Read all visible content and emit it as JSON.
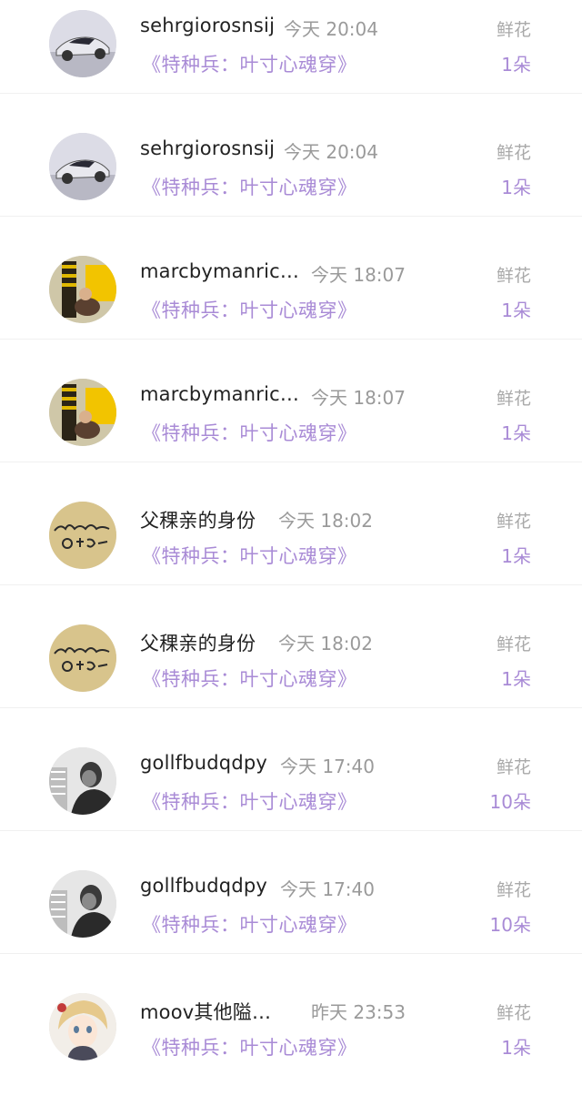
{
  "rows": [
    {
      "name": "sehrgiorosnsij",
      "time": "今天 20:04",
      "book": "《特种兵：叶寸心魂穿》",
      "gift": "鲜花",
      "count": "1朵",
      "avatar": "car-icon"
    },
    {
      "name": "sehrgiorosnsij",
      "time": "今天 20:04",
      "book": "《特种兵：叶寸心魂穿》",
      "gift": "鲜花",
      "count": "1朵",
      "avatar": "car-icon"
    },
    {
      "name": "marcbymanric…",
      "time": "今天 18:07",
      "book": "《特种兵：叶寸心魂穿》",
      "gift": "鲜花",
      "count": "1朵",
      "avatar": "photo-icon"
    },
    {
      "name": "marcbymanric…",
      "time": "今天 18:07",
      "book": "《特种兵：叶寸心魂穿》",
      "gift": "鲜花",
      "count": "1朵",
      "avatar": "photo-icon"
    },
    {
      "name": "父稞亲的身份",
      "time": "今天 18:02",
      "book": "《特种兵：叶寸心魂穿》",
      "gift": "鲜花",
      "count": "1朵",
      "avatar": "handwriting-icon"
    },
    {
      "name": "父稞亲的身份",
      "time": "今天 18:02",
      "book": "《特种兵：叶寸心魂穿》",
      "gift": "鲜花",
      "count": "1朵",
      "avatar": "handwriting-icon"
    },
    {
      "name": "gollfbudqdpy",
      "time": "今天 17:40",
      "book": "《特种兵：叶寸心魂穿》",
      "gift": "鲜花",
      "count": "10朵",
      "avatar": "portrait-bw-icon"
    },
    {
      "name": "gollfbudqdpy",
      "time": "今天 17:40",
      "book": "《特种兵：叶寸心魂穿》",
      "gift": "鲜花",
      "count": "10朵",
      "avatar": "portrait-bw-icon"
    },
    {
      "name": "moov其他隘…",
      "time": "昨天 23:53",
      "book": "《特种兵：叶寸心魂穿》",
      "gift": "鲜花",
      "count": "1朵",
      "avatar": "anime-icon"
    }
  ],
  "colors": {
    "name": "#222222",
    "meta": "#9a9a9a",
    "accent": "#a98bd6"
  }
}
